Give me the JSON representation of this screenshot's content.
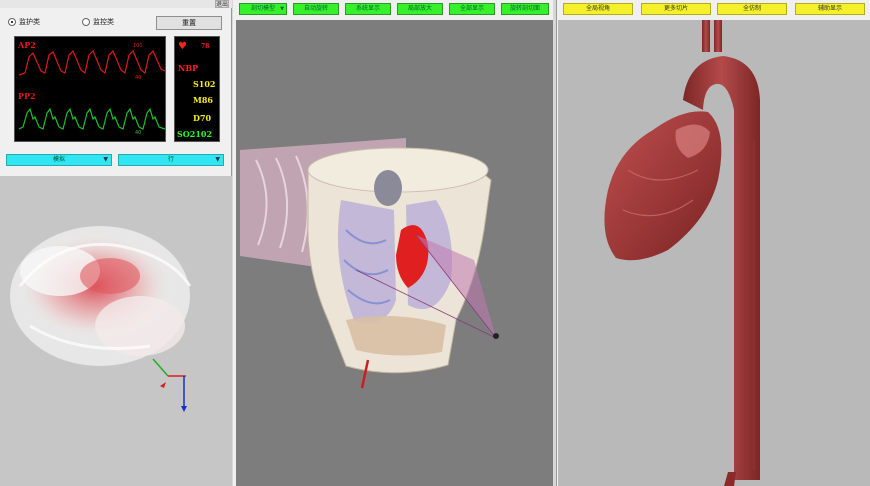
{
  "left_panel": {
    "close_label": "退出",
    "radio_options": [
      {
        "label": "监护类",
        "selected": true
      },
      {
        "label": "监控类",
        "selected": false
      }
    ],
    "reset_button": "重置",
    "monitor": {
      "wave1_label": "AP2",
      "wave2_label": "PP2",
      "wave1_scale_top": "100",
      "wave1_scale_bottom": "40",
      "wave2_scale_top": "",
      "wave2_scale_bottom": "40"
    },
    "vitals": {
      "heart_rate": "78",
      "nbp_label": "NBP",
      "s_value": "S102",
      "m_value": "M86",
      "d_value": "D70",
      "spo2": "SO2102"
    },
    "dropdowns": [
      {
        "label": "模拟"
      },
      {
        "label": "行"
      }
    ]
  },
  "center_panel": {
    "buttons": [
      {
        "label": "剖切模型",
        "has_arrow": true
      },
      {
        "label": "自动旋转",
        "has_arrow": false
      },
      {
        "label": "系统显示",
        "has_arrow": false
      },
      {
        "label": "局部放大",
        "has_arrow": false
      },
      {
        "label": "全部显示",
        "has_arrow": false
      },
      {
        "label": "旋转剖切面",
        "has_arrow": false
      }
    ]
  },
  "right_panel": {
    "buttons": [
      {
        "label": "全局视角"
      },
      {
        "label": "更多切片"
      },
      {
        "label": "全仿制"
      },
      {
        "label": "辅助显示"
      }
    ]
  },
  "colors": {
    "green_button": "#35f02a",
    "yellow_button": "#f4f02a",
    "cyan_dropdown": "#2fe6f2",
    "ap_wave": "#e01818",
    "pp_wave": "#19c424",
    "vital_yellow": "#f5ee1a",
    "vital_red": "#ff2020",
    "vital_green": "#20ff20"
  }
}
